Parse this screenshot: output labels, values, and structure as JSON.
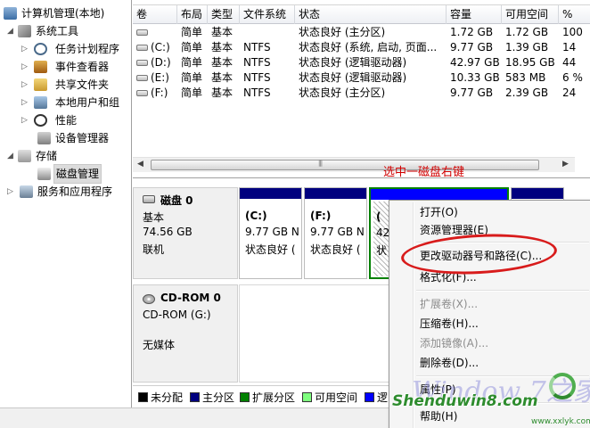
{
  "tree": {
    "root": "计算机管理(本地)",
    "system_tools": "系统工具",
    "task_scheduler": "任务计划程序",
    "event_viewer": "事件查看器",
    "shared_folders": "共享文件夹",
    "local_users": "本地用户和组",
    "performance": "性能",
    "device_manager": "设备管理器",
    "storage": "存储",
    "disk_management": "磁盘管理",
    "services_apps": "服务和应用程序"
  },
  "volume_list": {
    "columns": [
      "卷",
      "布局",
      "类型",
      "文件系统",
      "状态",
      "容量",
      "可用空间",
      "%"
    ],
    "rows": [
      [
        "",
        "简单",
        "基本",
        "",
        "状态良好 (主分区)",
        "1.72 GB",
        "1.72 GB",
        "100"
      ],
      [
        "(C:)",
        "简单",
        "基本",
        "NTFS",
        "状态良好 (系统, 启动, 页面...",
        "9.77 GB",
        "1.39 GB",
        "14"
      ],
      [
        "(D:)",
        "简单",
        "基本",
        "NTFS",
        "状态良好 (逻辑驱动器)",
        "42.97 GB",
        "18.95 GB",
        "44"
      ],
      [
        "(E:)",
        "简单",
        "基本",
        "NTFS",
        "状态良好 (逻辑驱动器)",
        "10.33 GB",
        "583 MB",
        "6 %"
      ],
      [
        "(F:)",
        "简单",
        "基本",
        "NTFS",
        "状态良好 (主分区)",
        "9.77 GB",
        "2.39 GB",
        "24"
      ]
    ]
  },
  "disk0": {
    "name": "磁盘 0",
    "type": "基本",
    "size": "74.56 GB",
    "status": "联机",
    "partitions": [
      {
        "letter": "(C:)",
        "size": "9.77 GB N",
        "status": "状态良好 ("
      },
      {
        "letter": "(F:)",
        "size": "9.77 GB N",
        "status": "状态良好 ("
      },
      {
        "letter": "(",
        "size": "42",
        "status": "状"
      }
    ]
  },
  "cdrom0": {
    "name": "CD-ROM 0",
    "device": "CD-ROM (G:)",
    "media": "无媒体"
  },
  "legend": [
    "未分配",
    "主分区",
    "扩展分区",
    "可用空间",
    "逻"
  ],
  "legend_colors": [
    "#000000",
    "#00007f",
    "#008000",
    "#7fff7f",
    "#0000ff"
  ],
  "context_menu": {
    "open": "打开(O)",
    "explore": "资源管理器(E)",
    "change_letter": "更改驱动器号和路径(C)...",
    "format": "格式化(F)...",
    "extend": "扩展卷(X)...",
    "shrink": "压缩卷(H)...",
    "add_mirror": "添加镜像(A)...",
    "delete": "删除卷(D)...",
    "properties": "属性(P)",
    "help": "帮助(H)"
  },
  "annotation": "选中一磁盘右键",
  "watermarks": {
    "windows": "Window 7之家",
    "site": "Shenduwin8.com",
    "site_small": "www.xxlyk.com"
  }
}
